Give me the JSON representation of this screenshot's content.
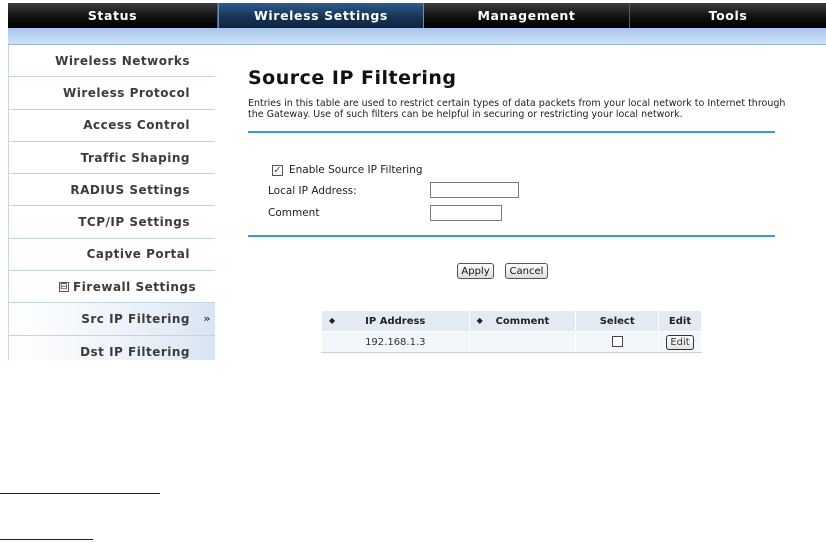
{
  "nav": {
    "tabs": [
      {
        "label": "Status"
      },
      {
        "label": "Wireless Settings"
      },
      {
        "label": "Management"
      },
      {
        "label": "Tools"
      }
    ]
  },
  "sidebar": {
    "items": [
      {
        "label": "Wireless Networks"
      },
      {
        "label": "Wireless Protocol"
      },
      {
        "label": "Access Control"
      },
      {
        "label": "Traffic Shaping"
      },
      {
        "label": "RADIUS Settings"
      },
      {
        "label": "TCP/IP Settings"
      },
      {
        "label": "Captive Portal"
      },
      {
        "label": "Firewall Settings",
        "fold": "⊟"
      },
      {
        "label": "Src IP Filtering",
        "arrow": "»"
      },
      {
        "label": "Dst IP Filtering"
      }
    ]
  },
  "main": {
    "title": "Source IP Filtering",
    "description": "Entries in this table are used to restrict certain types of data packets from your local network to Internet through the Gateway. Use of such filters can be helpful in securing or restricting your local network.",
    "enable_label": "Enable Source IP Filtering",
    "enable_checked": true,
    "check_mark": "✓",
    "local_ip_label": "Local IP Address:",
    "local_ip_value": "",
    "comment_label": "Comment",
    "comment_value": "",
    "apply_label": "Apply",
    "cancel_label": "Cancel"
  },
  "table": {
    "sort_glyph": "◆",
    "headers": [
      "IP Address",
      "Comment",
      "Select",
      "Edit"
    ],
    "rows": [
      {
        "ip": "192.168.1.3",
        "comment": "",
        "edit_label": "Edit"
      }
    ]
  },
  "colors": {
    "nav_active": "#163455",
    "subbar": "#bcd3f2",
    "rule": "#3b9fc4"
  }
}
